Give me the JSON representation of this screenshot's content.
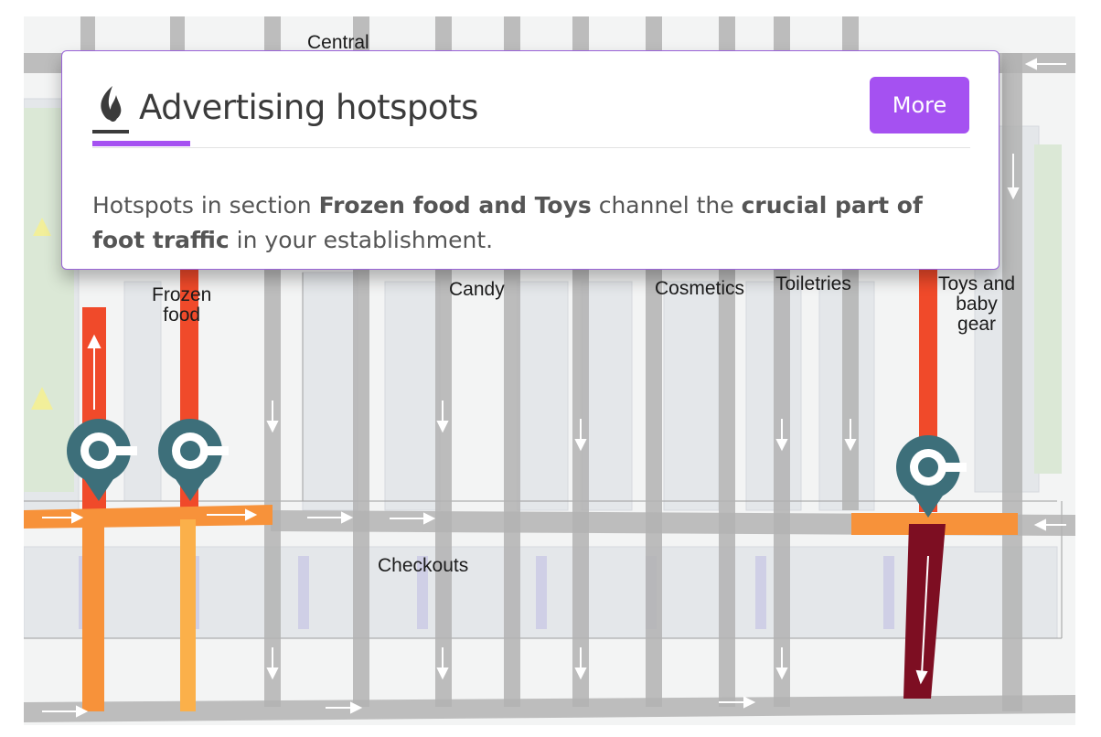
{
  "card": {
    "title": "Advertising hotspots",
    "more_label": "More",
    "body": {
      "p1": "Hotspots in section ",
      "b1": "Frozen food and Toys",
      "p2": " channel the ",
      "b2": "crucial part of foot traffic",
      "p3": " in your establishment."
    }
  },
  "map": {
    "labels": {
      "central": "Central",
      "frozen_food": "Frozen\nfood",
      "candy": "Candy",
      "cosmetics": "Cosmetics",
      "toiletries": "Toiletries",
      "toys_baby_gear": "Toys and\nbaby\ngear",
      "checkouts": "Checkouts"
    }
  },
  "colors": {
    "accent": "#a551f1",
    "hot_red": "#f04a2a",
    "warm_orange": "#f7923a",
    "light_orange": "#fbb04a",
    "dark_red": "#7d0e22",
    "pin_teal": "#3d6f7a",
    "aisle_gray": "#b0b0b0"
  },
  "icons": {
    "title_icon": "flame-icon",
    "hotspot_pin": "hotspot-pin-icon"
  }
}
